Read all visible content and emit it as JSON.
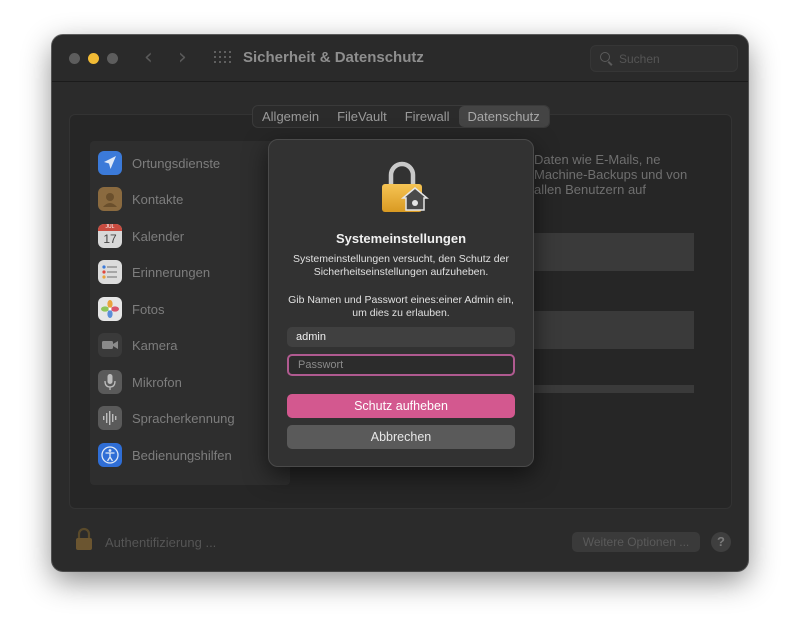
{
  "window": {
    "title": "Sicherheit & Datenschutz",
    "search_placeholder": "Suchen"
  },
  "tabs": [
    {
      "label": "Allgemein",
      "active": false
    },
    {
      "label": "FileVault",
      "active": false
    },
    {
      "label": "Firewall",
      "active": false
    },
    {
      "label": "Datenschutz",
      "active": true
    }
  ],
  "sidebar": {
    "items": [
      {
        "label": "Ortungsdienste",
        "icon": "location-arrow-icon",
        "color": "#3b7ad9"
      },
      {
        "label": "Kontakte",
        "icon": "contacts-book-icon",
        "color": "#a0763f"
      },
      {
        "label": "Kalender",
        "icon": "calendar-icon",
        "color": "#e8e8e8",
        "badge_month": "JUL",
        "badge_day": "17"
      },
      {
        "label": "Erinnerungen",
        "icon": "reminders-list-icon",
        "color": "#e8e8e8"
      },
      {
        "label": "Fotos",
        "icon": "photos-flower-icon",
        "color": "#f2f2f2"
      },
      {
        "label": "Kamera",
        "icon": "camera-icon",
        "color": "#3a3a3a"
      },
      {
        "label": "Mikrofon",
        "icon": "microphone-icon",
        "color": "#5a5a5a"
      },
      {
        "label": "Spracherkennung",
        "icon": "waveform-icon",
        "color": "#5a5a5a"
      },
      {
        "label": "Bedienungshilfen",
        "icon": "accessibility-icon",
        "color": "#2f6ed6"
      }
    ]
  },
  "content": {
    "description_visible": "Daten wie E-Mails, ne Machine-Backups und von allen Benutzern auf"
  },
  "bottom": {
    "auth_text": "Authentifizierung ...",
    "more_options": "Weitere Optionen ...",
    "help": "?"
  },
  "dialog": {
    "title": "Systemeinstellungen",
    "message1": "Systemeinstellungen versucht, den Schutz der Sicherheitseinstellungen aufzuheben.",
    "message2": "Gib Namen und Passwort eines:einer Admin ein, um dies zu erlauben.",
    "username_value": "admin",
    "password_placeholder": "Passwort",
    "primary_button": "Schutz aufheben",
    "cancel_button": "Abbrechen",
    "accent_color": "#d3588f"
  }
}
